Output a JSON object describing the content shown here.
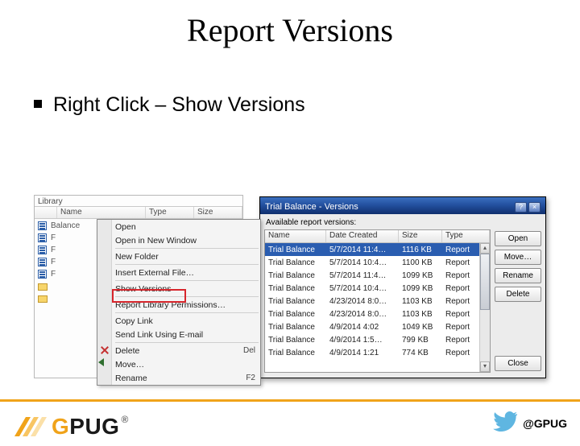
{
  "slide": {
    "title": "Report Versions",
    "bullet": "Right Click – Show Versions",
    "footer_handle": "@GPUG"
  },
  "library": {
    "title": "Library",
    "head": {
      "name": "Name",
      "type": "Type",
      "size": "Size"
    },
    "rows": [
      {
        "kind": "report",
        "label": "Balance"
      },
      {
        "kind": "report",
        "label": "F"
      },
      {
        "kind": "report",
        "label": "F"
      },
      {
        "kind": "report",
        "label": "F"
      },
      {
        "kind": "report",
        "label": "F"
      },
      {
        "kind": "folder",
        "label": ""
      },
      {
        "kind": "folder",
        "label": ""
      }
    ]
  },
  "ctx": {
    "open": "Open",
    "open_new": "Open in New Window",
    "new_folder": "New Folder",
    "insert_ext": "Insert External File…",
    "show_versions": "Show Versions",
    "report_perms": "Report Library Permissions…",
    "copy_link": "Copy Link",
    "send_link": "Send Link Using E-mail",
    "delete": "Delete",
    "delete_sc": "Del",
    "move": "Move…",
    "rename": "Rename",
    "rename_sc": "F2"
  },
  "dialog": {
    "title": "Trial Balance - Versions",
    "subtitle": "Available report versions:",
    "head": {
      "name": "Name",
      "date": "Date Created",
      "size": "Size",
      "type": "Type"
    },
    "rows": [
      {
        "n": "Trial Balance",
        "d": "5/7/2014 11:4…",
        "s": "1116 KB",
        "t": "Report",
        "sel": true
      },
      {
        "n": "Trial Balance",
        "d": "5/7/2014 10:4…",
        "s": "1100 KB",
        "t": "Report"
      },
      {
        "n": "Trial Balance",
        "d": "5/7/2014 11:4…",
        "s": "1099 KB",
        "t": "Report"
      },
      {
        "n": "Trial Balance",
        "d": "5/7/2014 10:4…",
        "s": "1099 KB",
        "t": "Report"
      },
      {
        "n": "Trial Balance",
        "d": "4/23/2014 8:0…",
        "s": "1103 KB",
        "t": "Report"
      },
      {
        "n": "Trial Balance",
        "d": "4/23/2014 8:0…",
        "s": "1103 KB",
        "t": "Report"
      },
      {
        "n": "Trial Balance",
        "d": "4/9/2014 4:02",
        "s": "1049 KB",
        "t": "Report"
      },
      {
        "n": "Trial Balance",
        "d": "4/9/2014 1:5…",
        "s": "799 KB",
        "t": "Report"
      },
      {
        "n": "Trial Balance",
        "d": "4/9/2014 1:21",
        "s": "774 KB",
        "t": "Report"
      }
    ],
    "buttons": {
      "open": "Open",
      "move": "Move…",
      "rename": "Rename",
      "delete": "Delete",
      "close": "Close"
    }
  }
}
